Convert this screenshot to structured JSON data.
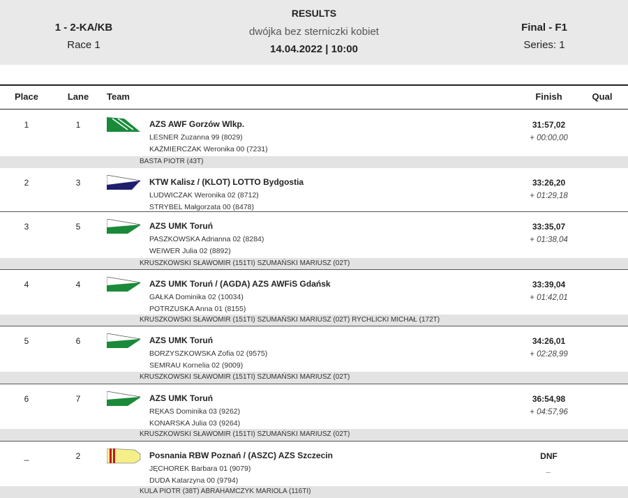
{
  "header": {
    "event": "1 - 2-KA/KB",
    "race": "Race 1",
    "title": "RESULTS",
    "subtitle": "dwójka bez sterniczki kobiet",
    "datetime": "14.04.2022 | 10:00",
    "final": "Final - F1",
    "series": "Series: 1"
  },
  "columns": {
    "place": "Place",
    "lane": "Lane",
    "team": "Team",
    "finish": "Finish",
    "qual": "Qual"
  },
  "rows": [
    {
      "place": "1",
      "lane": "1",
      "team": "AZS AWF Gorzów Wlkp.",
      "crew1": "LESNER  Zuzanna 99 (8029)",
      "crew2": "KAŹMIERCZAK  Weronika 00 (7231)",
      "time": "31:57,02",
      "diff": "+ 00:00,00",
      "coaches": "BASTA PIOTR (43T)",
      "boat": "azs-awf-blade",
      "boat_color": "#1a8a3a"
    },
    {
      "place": "2",
      "lane": "3",
      "team": "KTW Kalisz / (KLOT) LOTTO Bydgostia",
      "crew1": "LUDWICZAK  Weronika 02 (8712)",
      "crew2": "STRYBEL  Małgorzata 00 (8478)",
      "time": "33:26,20",
      "diff": "+ 01:29,18",
      "coaches": "",
      "boat": "ktw-blade",
      "boat_color": "#1f1f6e"
    },
    {
      "place": "3",
      "lane": "5",
      "team": "AZS UMK Toruń",
      "crew1": "PASZKOWSKA  Adrianna 02 (8284)",
      "crew2": "WEIWER  Julia 02 (8892)",
      "time": "33:35,07",
      "diff": "+ 01:38,04",
      "coaches": "KRUSZKOWSKI SŁAWOMIR (151TI) SZUMAŃSKI MARIUSZ (02T)",
      "boat": "azs-umk-blade",
      "boat_color": "#1a8a3a"
    },
    {
      "place": "4",
      "lane": "4",
      "team": "AZS UMK Toruń / (AGDA) AZS AWFiS Gdańsk",
      "crew1": "GAŁKA  Dominika 02 (10034)",
      "crew2": "POTRZUSKA  Anna 01 (8155)",
      "time": "33:39,04",
      "diff": "+ 01:42,01",
      "coaches": "KRUSZKOWSKI SŁAWOMIR (151TI) SZUMAŃSKI MARIUSZ (02T) RYCHLICKI MICHAŁ (172T)",
      "boat": "azs-umk-blade",
      "boat_color": "#1a8a3a"
    },
    {
      "place": "5",
      "lane": "6",
      "team": "AZS UMK Toruń",
      "crew1": "BORZYSZKOWSKA  Zofia 02 (9575)",
      "crew2": "SEMRAU  Kornelia 02 (9009)",
      "time": "34:26,01",
      "diff": "+ 02:28,99",
      "coaches": "KRUSZKOWSKI SŁAWOMIR (151TI) SZUMAŃSKI MARIUSZ (02T)",
      "boat": "azs-umk-blade",
      "boat_color": "#1a8a3a"
    },
    {
      "place": "6",
      "lane": "7",
      "team": "AZS UMK Toruń",
      "crew1": "RĘKAS  Dominika 03 (9262)",
      "crew2": "KONARSKA  Julia 03 (9264)",
      "time": "36:54,98",
      "diff": "+ 04:57,96",
      "coaches": "KRUSZKOWSKI SŁAWOMIR (151TI) SZUMAŃSKI MARIUSZ (02T)",
      "boat": "azs-umk-blade",
      "boat_color": "#1a8a3a"
    },
    {
      "place": "_",
      "lane": "2",
      "team": "Posnania RBW Poznań / (ASZC) AZS Szczecin",
      "crew1": "JĘCHOREK  Barbara 01 (9079)",
      "crew2": "DUDA  Katarzyna 00 (9794)",
      "time": "DNF",
      "diff": "_",
      "coaches": "KULA PIOTR (38T) ABRAHAMCZYK MARIOLA (116TI)",
      "boat": "posnania-blade",
      "boat_color": "#f5ef8a"
    }
  ]
}
